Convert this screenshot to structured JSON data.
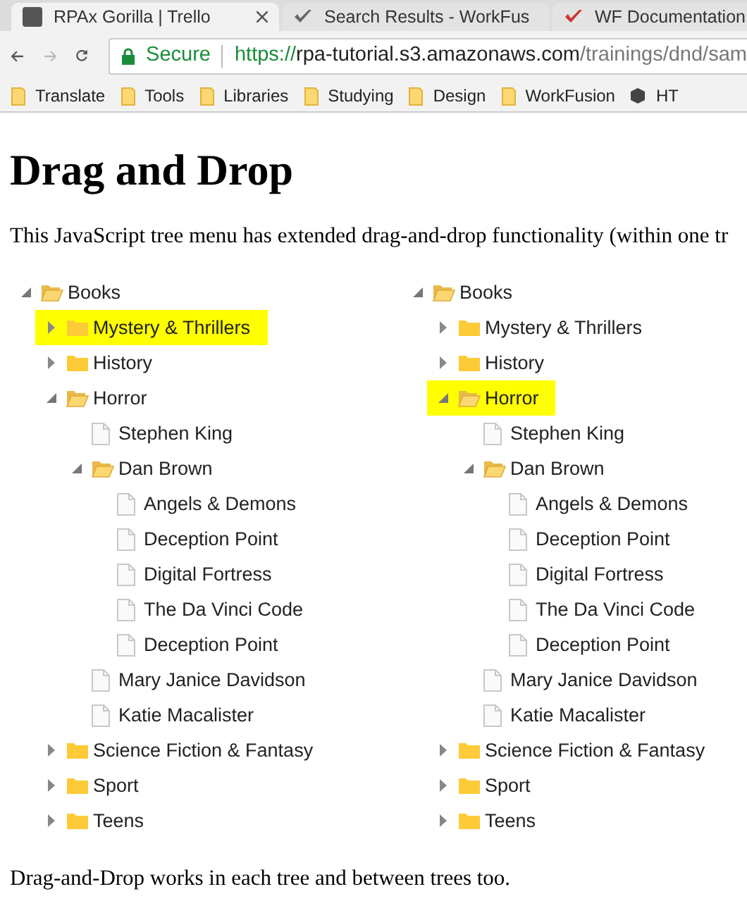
{
  "browser": {
    "tabs": [
      {
        "title": "RPAx Gorilla | Trello",
        "selected": true
      },
      {
        "title": "Search Results - WorkFus",
        "selected": false
      },
      {
        "title": "WF Documentation",
        "selected": false
      }
    ],
    "address": {
      "secure_label": "Secure",
      "url_host": "https://rpa-tutorial.s3.amazonaws.com",
      "url_path": "/trainings/dnd/sam"
    },
    "bookmarks": [
      {
        "label": "Translate",
        "kind": "folder"
      },
      {
        "label": "Tools",
        "kind": "folder"
      },
      {
        "label": "Libraries",
        "kind": "folder"
      },
      {
        "label": "Studying",
        "kind": "folder"
      },
      {
        "label": "Design",
        "kind": "folder"
      },
      {
        "label": "WorkFusion",
        "kind": "folder"
      },
      {
        "label": "HT",
        "kind": "site"
      }
    ]
  },
  "page": {
    "heading": "Drag and Drop",
    "intro": "This JavaScript tree menu has extended drag-and-drop functionality (within one tr",
    "trees": [
      {
        "nodes": [
          {
            "label": "Books",
            "kind": "folder",
            "expanded": true,
            "selected": false,
            "children": [
              {
                "label": "Mystery & Thrillers",
                "kind": "folder",
                "expanded": false,
                "selected": true
              },
              {
                "label": "History",
                "kind": "folder",
                "expanded": false,
                "selected": false
              },
              {
                "label": "Horror",
                "kind": "folder",
                "expanded": true,
                "selected": false,
                "children": [
                  {
                    "label": "Stephen King",
                    "kind": "file",
                    "selected": false
                  },
                  {
                    "label": "Dan Brown",
                    "kind": "folder",
                    "expanded": true,
                    "selected": false,
                    "children": [
                      {
                        "label": "Angels & Demons",
                        "kind": "file",
                        "selected": false
                      },
                      {
                        "label": "Deception Point",
                        "kind": "file",
                        "selected": false
                      },
                      {
                        "label": "Digital Fortress",
                        "kind": "file",
                        "selected": false
                      },
                      {
                        "label": "The Da Vinci Code",
                        "kind": "file",
                        "selected": false
                      },
                      {
                        "label": "Deception Point",
                        "kind": "file",
                        "selected": false
                      }
                    ]
                  },
                  {
                    "label": "Mary Janice Davidson",
                    "kind": "file",
                    "selected": false
                  },
                  {
                    "label": "Katie Macalister",
                    "kind": "file",
                    "selected": false
                  }
                ]
              },
              {
                "label": "Science Fiction & Fantasy",
                "kind": "folder",
                "expanded": false,
                "selected": false
              },
              {
                "label": "Sport",
                "kind": "folder",
                "expanded": false,
                "selected": false
              },
              {
                "label": "Teens",
                "kind": "folder",
                "expanded": false,
                "selected": false
              }
            ]
          }
        ]
      },
      {
        "nodes": [
          {
            "label": "Books",
            "kind": "folder",
            "expanded": true,
            "selected": false,
            "children": [
              {
                "label": "Mystery & Thrillers",
                "kind": "folder",
                "expanded": false,
                "selected": false
              },
              {
                "label": "History",
                "kind": "folder",
                "expanded": false,
                "selected": false
              },
              {
                "label": "Horror",
                "kind": "folder",
                "expanded": true,
                "selected": true,
                "children": [
                  {
                    "label": "Stephen King",
                    "kind": "file",
                    "selected": false
                  },
                  {
                    "label": "Dan Brown",
                    "kind": "folder",
                    "expanded": true,
                    "selected": false,
                    "children": [
                      {
                        "label": "Angels & Demons",
                        "kind": "file",
                        "selected": false
                      },
                      {
                        "label": "Deception Point",
                        "kind": "file",
                        "selected": false
                      },
                      {
                        "label": "Digital Fortress",
                        "kind": "file",
                        "selected": false
                      },
                      {
                        "label": "The Da Vinci Code",
                        "kind": "file",
                        "selected": false
                      },
                      {
                        "label": "Deception Point",
                        "kind": "file",
                        "selected": false
                      }
                    ]
                  },
                  {
                    "label": "Mary Janice Davidson",
                    "kind": "file",
                    "selected": false
                  },
                  {
                    "label": "Katie Macalister",
                    "kind": "file",
                    "selected": false
                  }
                ]
              },
              {
                "label": "Science Fiction & Fantasy",
                "kind": "folder",
                "expanded": false,
                "selected": false
              },
              {
                "label": "Sport",
                "kind": "folder",
                "expanded": false,
                "selected": false
              },
              {
                "label": "Teens",
                "kind": "folder",
                "expanded": false,
                "selected": false
              }
            ]
          }
        ]
      }
    ],
    "footer": "Drag-and-Drop works in each tree and between trees too."
  }
}
